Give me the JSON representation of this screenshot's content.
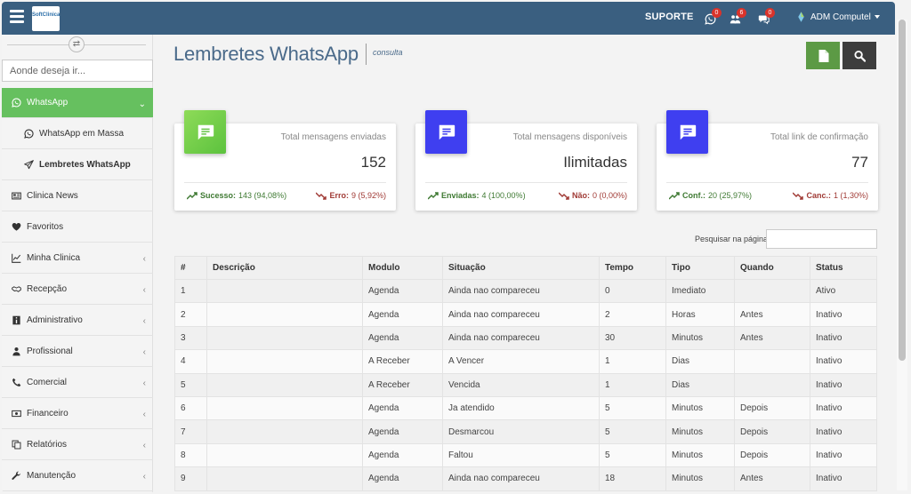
{
  "header": {
    "logo_text": "SoftClinica",
    "suporte": "SUPORTE",
    "icons": [
      {
        "name": "whatsapp-icon",
        "badge": "0"
      },
      {
        "name": "users-icon",
        "badge": "6"
      },
      {
        "name": "chat-icon",
        "badge": "0"
      }
    ],
    "user": "ADM Computel"
  },
  "sidebar": {
    "search_placeholder": "Aonde deseja ir...",
    "items": [
      {
        "label": "WhatsApp",
        "icon": "whatsapp-icon",
        "active": true,
        "chevron": "down"
      },
      {
        "label": "WhatsApp em Massa",
        "icon": "whatsapp-icon",
        "sub": true
      },
      {
        "label": "Lembretes WhatsApp",
        "icon": "send-icon",
        "sub": true,
        "bold": true
      },
      {
        "label": "Clinica News",
        "icon": "newspaper-icon"
      },
      {
        "label": "Favoritos",
        "icon": "heart-icon"
      },
      {
        "label": "Minha Clinica",
        "icon": "chart-icon",
        "chevron": "left"
      },
      {
        "label": "Recepção",
        "icon": "handshake-icon",
        "chevron": "left"
      },
      {
        "label": "Administrativo",
        "icon": "info-icon",
        "chevron": "left"
      },
      {
        "label": "Profissional",
        "icon": "doctor-icon",
        "chevron": "left"
      },
      {
        "label": "Comercial",
        "icon": "phone-icon",
        "chevron": "left"
      },
      {
        "label": "Financeiro",
        "icon": "money-icon",
        "chevron": "left"
      },
      {
        "label": "Relatórios",
        "icon": "copy-icon",
        "chevron": "left"
      },
      {
        "label": "Manutenção",
        "icon": "wrench-icon",
        "chevron": "left"
      }
    ]
  },
  "page": {
    "title": "Lembretes WhatsApp",
    "subtitle": "consulta"
  },
  "cards": [
    {
      "label": "Total mensagens enviadas",
      "value": "152",
      "color": "#7ed04f",
      "left_label": "Sucesso:",
      "left_value": "143 (94,08%)",
      "right_label": "Erro:",
      "right_value": "9 (5,92%)"
    },
    {
      "label": "Total mensagens disponíveis",
      "value": "Ilimitadas",
      "color": "#3f3ff0",
      "left_label": "Enviadas:",
      "left_value": "4 (100,00%)",
      "right_label": "Não:",
      "right_value": "0 (0,00%)"
    },
    {
      "label": "Total link de confirmação",
      "value": "77",
      "color": "#3f3ff0",
      "left_label": "Conf.:",
      "left_value": "20 (25,97%)",
      "right_label": "Canc.:",
      "right_value": "1 (1,30%)"
    }
  ],
  "search": {
    "label": "Pesquisar na página",
    "value": ""
  },
  "table": {
    "headers": [
      "#",
      "Descrição",
      "Modulo",
      "Situação",
      "Tempo",
      "Tipo",
      "Quando",
      "Status"
    ],
    "rows": [
      [
        "1",
        "",
        "Agenda",
        "Ainda nao compareceu",
        "0",
        "Imediato",
        "",
        "Ativo"
      ],
      [
        "2",
        "",
        "Agenda",
        "Ainda nao compareceu",
        "2",
        "Horas",
        "Antes",
        "Inativo"
      ],
      [
        "3",
        "",
        "Agenda",
        "Ainda nao compareceu",
        "30",
        "Minutos",
        "Antes",
        "Inativo"
      ],
      [
        "4",
        "",
        "A Receber",
        "A Vencer",
        "1",
        "Dias",
        "",
        "Inativo"
      ],
      [
        "5",
        "",
        "A Receber",
        "Vencida",
        "1",
        "Dias",
        "",
        "Inativo"
      ],
      [
        "6",
        "",
        "Agenda",
        "Ja atendido",
        "5",
        "Minutos",
        "Depois",
        "Inativo"
      ],
      [
        "7",
        "",
        "Agenda",
        "Desmarcou",
        "5",
        "Minutos",
        "Depois",
        "Inativo"
      ],
      [
        "8",
        "",
        "Agenda",
        "Faltou",
        "5",
        "Minutos",
        "Depois",
        "Inativo"
      ],
      [
        "9",
        "",
        "Agenda",
        "Ainda nao compareceu",
        "18",
        "Minutos",
        "Antes",
        "Inativo"
      ]
    ]
  }
}
